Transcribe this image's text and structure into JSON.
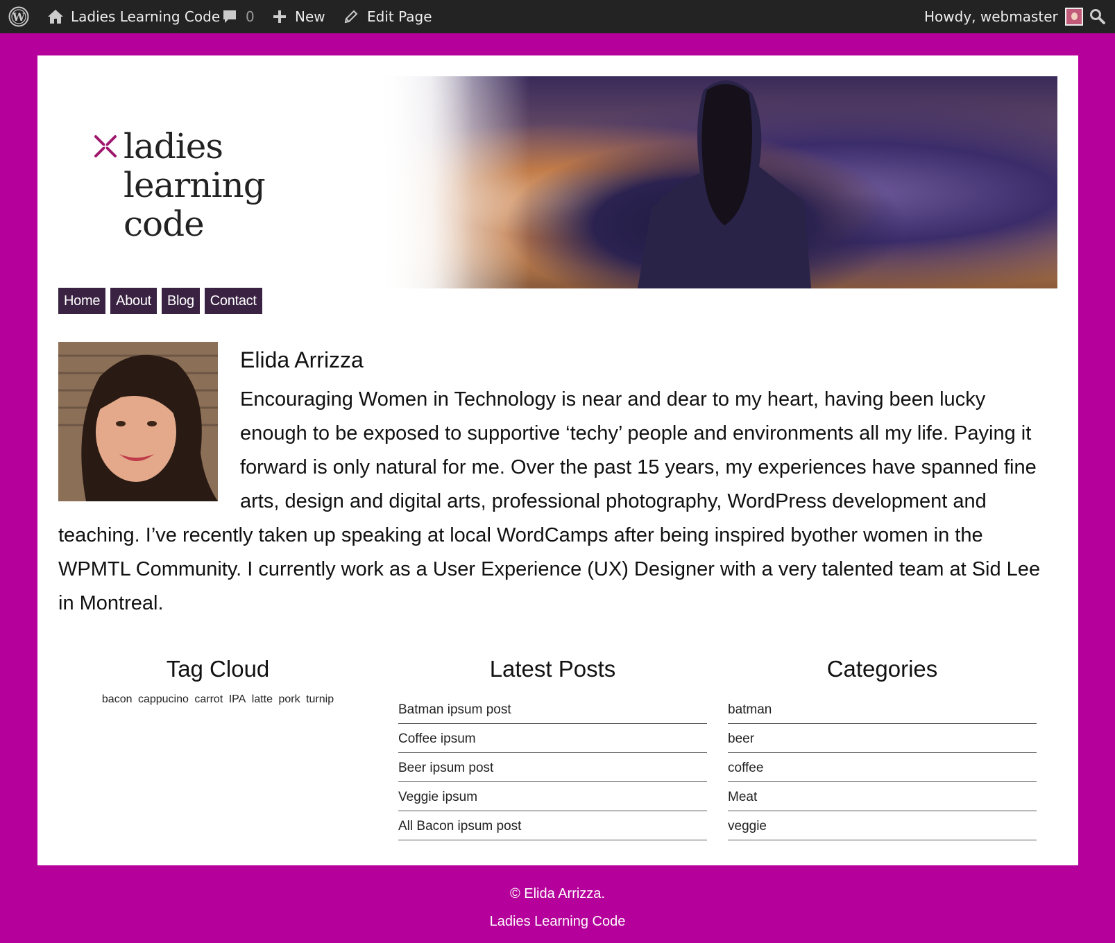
{
  "adminbar": {
    "site_name": "Ladies Learning Code",
    "comments_count": "0",
    "new_label": "New",
    "edit_label": "Edit Page",
    "howdy": "Howdy, webmaster"
  },
  "logo": {
    "line1": "ladies",
    "line2": "learning",
    "line3": "code"
  },
  "nav": [
    "Home",
    "About",
    "Blog",
    "Contact"
  ],
  "bio": {
    "name": "Elida Arrizza",
    "text": "Encouraging Women in Technology is near and dear to my heart, having been lucky enough to be exposed to supportive ‘techy’ people and environments all my life. Paying it forward is only natural for me. Over the past 15 years, my experiences have spanned fine arts, design and digital arts, professional photography, WordPress development and teaching. I’ve recently taken up speaking at local WordCamps after being inspired byother women in the WPMTL Community. I currently work as a User Experience (UX) Designer with a very talented team at Sid Lee in Montreal."
  },
  "widgets": {
    "tag_cloud": {
      "title": "Tag Cloud",
      "tags": [
        "bacon",
        "cappucino",
        "carrot",
        "IPA",
        "latte",
        "pork",
        "turnip"
      ]
    },
    "latest_posts": {
      "title": "Latest Posts",
      "items": [
        "Batman ipsum post",
        "Coffee ipsum",
        "Beer ipsum post",
        "Veggie ipsum",
        "All Bacon ipsum post"
      ]
    },
    "categories": {
      "title": "Categories",
      "items": [
        "batman",
        "beer",
        "coffee",
        "Meat",
        "veggie"
      ]
    }
  },
  "footer": {
    "copyright": "© Elida Arrizza.",
    "site": "Ladies Learning Code"
  },
  "colors": {
    "background": "#b5009b",
    "adminbar": "#232323",
    "nav": "#3a2342",
    "logo_mark": "#a0166e"
  }
}
